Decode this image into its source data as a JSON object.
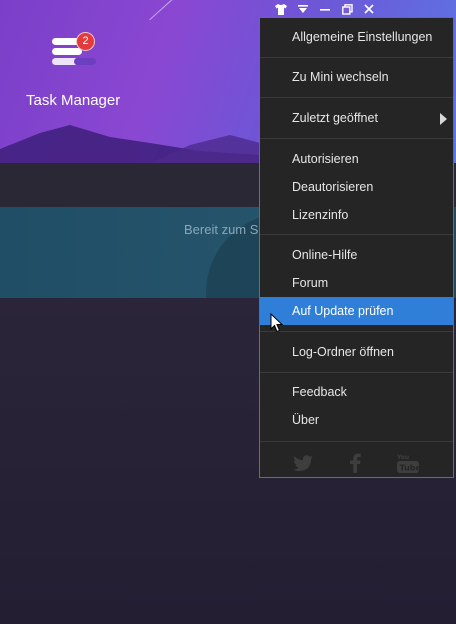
{
  "app": {
    "title": "Task Manager",
    "badge_count": "2",
    "status_text": "Bereit zum S"
  },
  "titlebar": {
    "icons": [
      "shirt-icon",
      "dropdown-icon",
      "minimize-icon",
      "restore-icon",
      "close-icon"
    ]
  },
  "menu": {
    "items": [
      {
        "label": "Allgemeine Einstellungen"
      },
      {
        "label": "Zu Mini wechseln"
      },
      {
        "label": "Zuletzt geöffnet",
        "has_submenu": true
      },
      {
        "label": "Autorisieren"
      },
      {
        "label": "Deautorisieren"
      },
      {
        "label": "Lizenzinfo"
      },
      {
        "label": "Online-Hilfe"
      },
      {
        "label": "Forum"
      },
      {
        "label": "Auf Update prüfen",
        "highlighted": true
      },
      {
        "label": "Log-Ordner öffnen"
      },
      {
        "label": "Feedback"
      },
      {
        "label": "Über"
      }
    ],
    "social": [
      "twitter-icon",
      "facebook-icon",
      "youtube-icon"
    ]
  },
  "colors": {
    "menu_bg": "#252525",
    "menu_border": "#2c7fb8",
    "highlight": "#2f7fd8",
    "badge": "#e23b3b"
  }
}
